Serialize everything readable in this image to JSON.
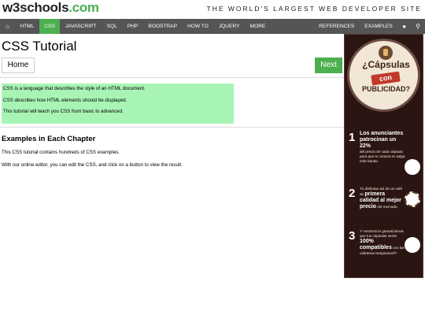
{
  "header": {
    "logo_main": "w3schools",
    "logo_suffix": ".com",
    "tagline": "THE WORLD'S LARGEST WEB DEVELOPER SITE"
  },
  "nav": {
    "home_icon": "home-icon",
    "items": [
      {
        "label": "HTML",
        "active": false
      },
      {
        "label": "CSS",
        "active": true
      },
      {
        "label": "JAVASCRIPT",
        "active": false
      },
      {
        "label": "SQL",
        "active": false
      },
      {
        "label": "PHP",
        "active": false
      },
      {
        "label": "BOOSTRAP",
        "active": false
      },
      {
        "label": "HOW TO",
        "active": false
      },
      {
        "label": "JQUERY",
        "active": false
      },
      {
        "label": "MORE",
        "active": false
      }
    ],
    "right_items": [
      {
        "label": "REFERENCES"
      },
      {
        "label": "EXAMPLES"
      }
    ],
    "globe_icon": "globe-icon",
    "search_icon": "search-icon"
  },
  "main": {
    "title": "CSS Tutorial",
    "home_button": "Home",
    "next_button": "Next",
    "note_lines": [
      "CSS is a language that describes the style of an HTML document.",
      "CSS describes how HTML elements should be displayed.",
      "This tutorial will teach you CSS from basic to advanced."
    ],
    "section_title": "Examples in Each Chapter",
    "para1": "This CSS tutorial contains hundreds of CSS examples.",
    "para2": "With our online editor, you can edit the CSS, and click on a button to view the result."
  },
  "ad": {
    "headline_top": "¿Cápsulas",
    "headline_mid": "con",
    "headline_bottom": "PUBLICIDAD?",
    "row1": {
      "num": "1",
      "bold": "Los anunciantes patrocinan un 22%",
      "rest": "del precio de cada cápsula para que tu compra te salga más barato."
    },
    "row2": {
      "num": "2",
      "pre": "Tú disfrutas así de un café de ",
      "bold": "primera calidad al mejor precio",
      "rest": " del mercado."
    },
    "row3": {
      "num": "3",
      "pre": "Y nosotros te garantizamos que tus cápsulas serán ",
      "bold": "100% compatibles",
      "rest": " con las cafeteras Nespresso®*"
    }
  },
  "colors": {
    "accent": "#4CAF50",
    "nav_bg": "#555555",
    "note_bg": "#a8f4b5",
    "ad_bg": "#2a1513"
  }
}
